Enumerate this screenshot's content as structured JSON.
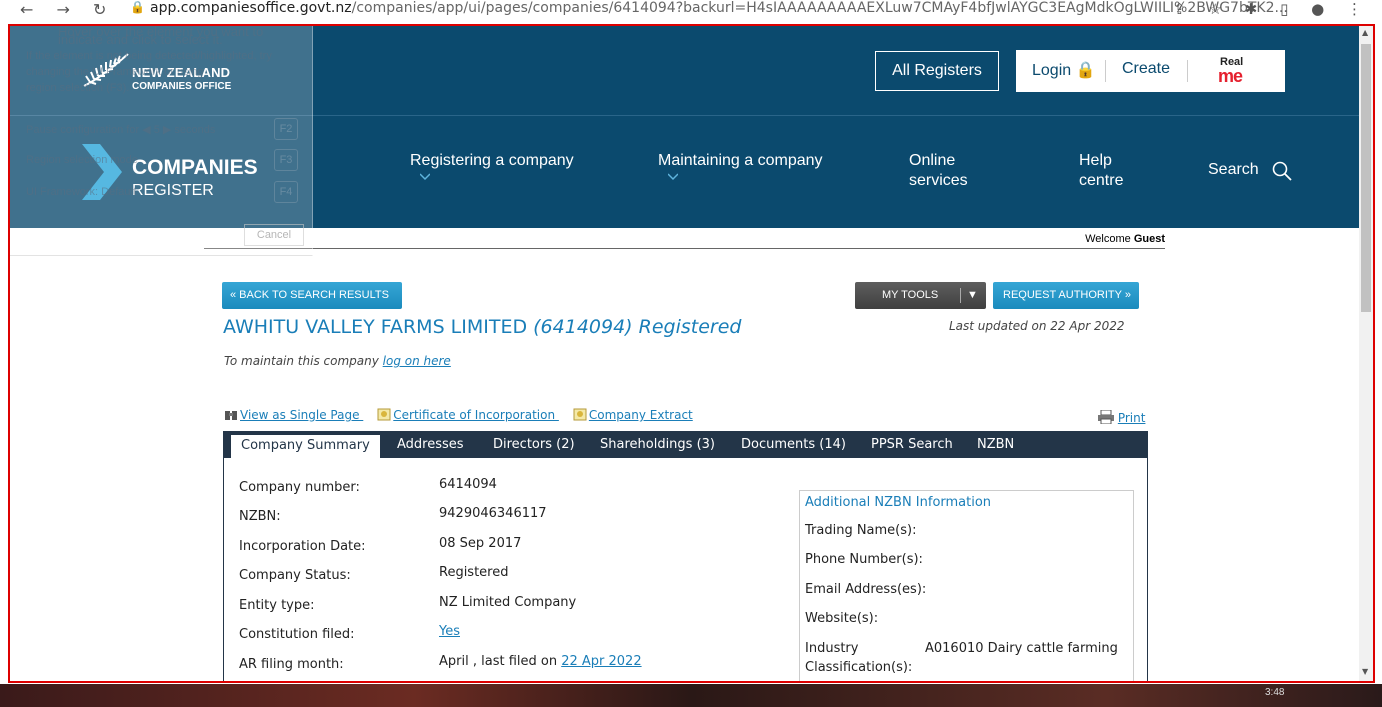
{
  "browser": {
    "url_host": "app.companiesoffice.govt.nz",
    "url_path": "/companies/app/ui/pages/companies/6414094?backurl=H4sIAAAAAAAAAEXLuw7CMAyF4bfJwlAYGC3EAgMdkOgLWIILI%2BWG7bTK2..."
  },
  "overlay": {
    "line1": "Hover over the element you want to",
    "line2": "indicate and click to select it.",
    "p1": "If the element is not being detected/highlighted, try",
    "p2": "changing the UI Framework or using",
    "p3": "region selection (F3).",
    "pause": "Pause configuration for  ◀ 5 ▶  seconds",
    "region": "Region selection mode",
    "framework": "UI Framework: Default",
    "k2": "F2",
    "k3": "F3",
    "k4": "F4",
    "cancel": "Cancel"
  },
  "header": {
    "nz_line1": "NEW ZEALAND",
    "nz_line2": "COMPANIES OFFICE",
    "all_registers": "All Registers",
    "login": "Login",
    "create": "Create",
    "realme_top": "Real",
    "realme_bottom": "me",
    "reg_line1": "COMPANIES",
    "reg_line2": "REGISTER",
    "nav": {
      "registering": "Registering a company",
      "maintaining": "Maintaining a company",
      "online1": "Online",
      "online2": "services",
      "help1": "Help",
      "help2": "centre",
      "search": "Search"
    }
  },
  "welcome": {
    "label": "Welcome",
    "user": "Guest"
  },
  "actions": {
    "back": "« BACK TO SEARCH RESULTS",
    "my_tools": "MY TOOLS",
    "my_tools_arrow": "▼",
    "request_authority": "REQUEST AUTHORITY »"
  },
  "company": {
    "name": "AWHITU VALLEY FARMS LIMITED",
    "number_status": "(6414094) Registered",
    "last_updated": "Last updated on 22 Apr 2022",
    "maintain_prefix": "To maintain this company ",
    "maintain_link": "log on here"
  },
  "doc_links": {
    "single_page": "View as Single Page ",
    "certificate": "Certificate of Incorporation ",
    "extract": "Company Extract",
    "print": "Print"
  },
  "tabs": [
    "Company Summary",
    "Addresses",
    "Directors (2)",
    "Shareholdings (3)",
    "Documents (14)",
    "PPSR Search",
    "NZBN"
  ],
  "summary": {
    "labels": {
      "number": "Company number:",
      "nzbn": "NZBN:",
      "inc_date": "Incorporation Date:",
      "status": "Company Status:",
      "entity": "Entity type:",
      "constitution": "Constitution filed:",
      "ar_month": "AR filing month:"
    },
    "values": {
      "number": "6414094",
      "nzbn": "9429046346117",
      "inc_date": "08 Sep 2017",
      "status": "Registered",
      "entity": "NZ Limited Company",
      "constitution": "Yes",
      "ar_month_prefix": "April , last filed on ",
      "ar_month_link": "22 Apr 2022"
    }
  },
  "nzbn_info": {
    "heading": "Additional NZBN Information",
    "trading": "Trading Name(s):",
    "phone": "Phone Number(s):",
    "email": "Email Address(es):",
    "website": "Website(s):",
    "industry1": "Industry",
    "industry2": "Classification(s):",
    "industry_value": "A016010 Dairy cattle farming"
  },
  "taskbar": {
    "time": "3:48"
  },
  "colors": {
    "header": "#0b4a6e",
    "accent": "#1a7eb8",
    "tabbar": "#233548",
    "highlight_border": "#dd0000"
  }
}
